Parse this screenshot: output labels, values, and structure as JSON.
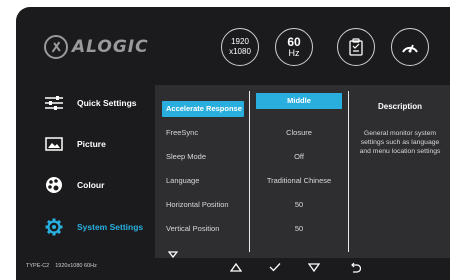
{
  "brand": {
    "logo_text": "ALOGIC"
  },
  "header": {
    "resolution_line1": "1920",
    "resolution_line2": "x1080",
    "refresh_value": "60",
    "refresh_unit": "Hz",
    "icons": [
      "clipboard-check-icon",
      "speedometer-icon"
    ]
  },
  "sidebar": {
    "items": [
      {
        "label": "Quick Settings",
        "icon": "sliders-icon",
        "active": false
      },
      {
        "label": "Picture",
        "icon": "picture-icon",
        "active": false
      },
      {
        "label": "Colour",
        "icon": "palette-icon",
        "active": false
      },
      {
        "label": "System Settings",
        "icon": "gear-icon",
        "active": true
      }
    ]
  },
  "menu": {
    "items": [
      {
        "label": "Accelerate Response",
        "value": "Middle",
        "selected": true
      },
      {
        "label": "FreeSync",
        "value": "Closure",
        "selected": false
      },
      {
        "label": "Sleep Mode",
        "value": "Off",
        "selected": false
      },
      {
        "label": "Language",
        "value": "Traditional Chinese",
        "selected": false
      },
      {
        "label": "Horizontal Position",
        "value": "50",
        "selected": false
      },
      {
        "label": "Vertical Position",
        "value": "50",
        "selected": false
      }
    ],
    "description_title": "Description",
    "description_text": "General monitor system settings such as language and menu location settings"
  },
  "footer": {
    "input": "TYPE-C2",
    "mode": "1920x1080 60Hz",
    "buttons": [
      "up-icon",
      "check-icon",
      "down-icon",
      "back-icon"
    ]
  },
  "colors": {
    "accent": "#2aaede",
    "background": "#1b1b1d",
    "panel": "#2e2e30"
  }
}
